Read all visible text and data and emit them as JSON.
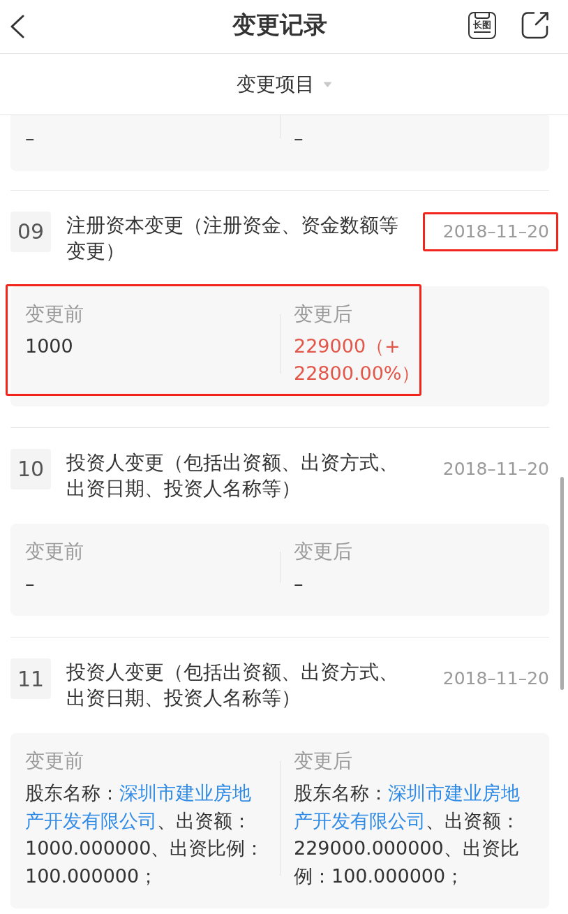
{
  "header": {
    "title": "变更记录",
    "long_image_label": "长图"
  },
  "filter": {
    "label": "变更项目"
  },
  "partial_record": {
    "before": {
      "value": "–",
      "emphasized": false
    },
    "after": {
      "value": "–",
      "emphasized": false
    }
  },
  "records": [
    {
      "number": "09",
      "title": "注册资本变更（注册资金、资金数额等变更）",
      "date": "2018–11–20",
      "date_highlighted": true,
      "changes_highlighted": true,
      "before": {
        "label": "变更前",
        "value": "1000",
        "emphasized": false
      },
      "after": {
        "label": "变更后",
        "value": "229000（+ 22800.00%）",
        "emphasized": true
      }
    },
    {
      "number": "10",
      "title": "投资人变更（包括出资额、出资方式、出资日期、投资人名称等）",
      "date": "2018–11–20",
      "date_highlighted": false,
      "changes_highlighted": false,
      "before": {
        "label": "变更前",
        "value": "–",
        "emphasized": false
      },
      "after": {
        "label": "变更后",
        "value": "–",
        "emphasized": false
      }
    },
    {
      "number": "11",
      "title": "投资人变更（包括出资额、出资方式、出资日期、投资人名称等）",
      "date": "2018–11–20",
      "date_highlighted": false,
      "changes_highlighted": false,
      "before": {
        "label": "变更前",
        "emphasized": false,
        "segments": [
          {
            "kind": "text",
            "text": "股东名称："
          },
          {
            "kind": "link",
            "text": "深圳市建业房地"
          },
          {
            "kind": "link",
            "text": "产开发有限公司"
          },
          {
            "kind": "text",
            "text": "、出资额：1000.000000、出资比例：100.000000；"
          }
        ]
      },
      "after": {
        "label": "变更后",
        "emphasized": false,
        "segments": [
          {
            "kind": "text",
            "text": "股东名称："
          },
          {
            "kind": "link",
            "text": "深圳市建业房地"
          },
          {
            "kind": "link",
            "text": "产开发有限公司"
          },
          {
            "kind": "text",
            "text": "、出资额：229000.000000、出资比例：100.000000；"
          }
        ]
      }
    }
  ]
}
